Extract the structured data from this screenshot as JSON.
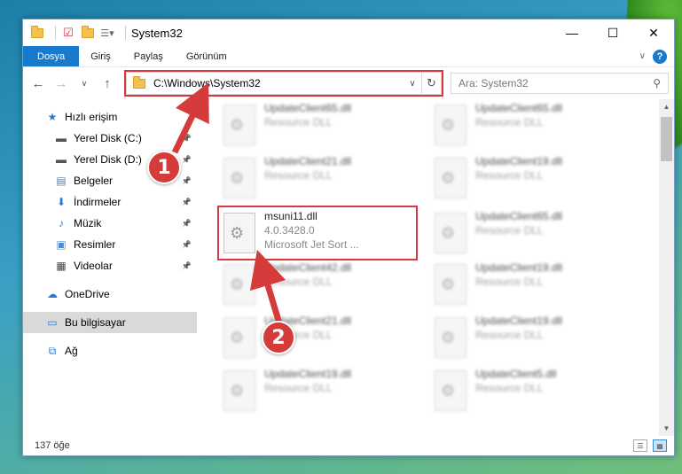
{
  "window": {
    "title": "System32",
    "controls": {
      "minimize": "—",
      "maximize": "☐",
      "close": "✕"
    }
  },
  "ribbon": {
    "tabs": [
      "Dosya",
      "Giriş",
      "Paylaş",
      "Görünüm"
    ],
    "help": "?"
  },
  "address": {
    "path": "C:\\Windows\\System32",
    "search_placeholder": "Ara: System32"
  },
  "sidebar": {
    "items": [
      {
        "label": "Hızlı erişim",
        "icon": "star-icon",
        "pinned": false,
        "level": 1
      },
      {
        "label": "Yerel Disk (C:)",
        "icon": "drive-icon",
        "pinned": true,
        "level": 2
      },
      {
        "label": "Yerel Disk (D:)",
        "icon": "drive-icon",
        "pinned": true,
        "level": 2
      },
      {
        "label": "Belgeler",
        "icon": "document-icon",
        "pinned": true,
        "level": 2
      },
      {
        "label": "İndirmeler",
        "icon": "download-icon",
        "pinned": true,
        "level": 2
      },
      {
        "label": "Müzik",
        "icon": "music-icon",
        "pinned": true,
        "level": 2
      },
      {
        "label": "Resimler",
        "icon": "picture-icon",
        "pinned": true,
        "level": 2
      },
      {
        "label": "Videolar",
        "icon": "video-icon",
        "pinned": true,
        "level": 2
      },
      {
        "label": "OneDrive",
        "icon": "cloud-icon",
        "pinned": false,
        "level": 1
      },
      {
        "label": "Bu bilgisayar",
        "icon": "computer-icon",
        "pinned": false,
        "level": 1,
        "selected": true
      },
      {
        "label": "Ağ",
        "icon": "network-icon",
        "pinned": false,
        "level": 1
      }
    ]
  },
  "files": {
    "col1": [
      {
        "name": "UpdateClient65.dll",
        "sub": "Resource DLL"
      },
      {
        "name": "UpdateClient21.dll",
        "sub": "Resource DLL"
      },
      {
        "name": "msuni11.dll",
        "sub": "4.0.3428.0",
        "sub2": "Microsoft Jet Sort ...",
        "highlight": true
      },
      {
        "name": "UpdateClient42.dll",
        "sub": "Resource DLL"
      },
      {
        "name": "UpdateClient21.dll",
        "sub": "Resource DLL"
      },
      {
        "name": "UpdateClient19.dll",
        "sub": "Resource DLL"
      }
    ],
    "col2": [
      {
        "name": "UpdateClient65.dll",
        "sub": "Resource DLL"
      },
      {
        "name": "UpdateClient19.dll",
        "sub": "Resource DLL"
      },
      {
        "name": "UpdateClient65.dll",
        "sub": "Resource DLL"
      },
      {
        "name": "UpdateClient19.dll",
        "sub": "Resource DLL"
      },
      {
        "name": "UpdateClient19.dll",
        "sub": "Resource DLL"
      },
      {
        "name": "UpdateClient5.dll",
        "sub": "Resource DLL"
      }
    ]
  },
  "status": {
    "count": "137 öğe"
  },
  "markers": [
    "1",
    "2"
  ],
  "colors": {
    "accent": "#1979ca",
    "highlight": "#d9363e",
    "marker": "#d63b3b"
  }
}
